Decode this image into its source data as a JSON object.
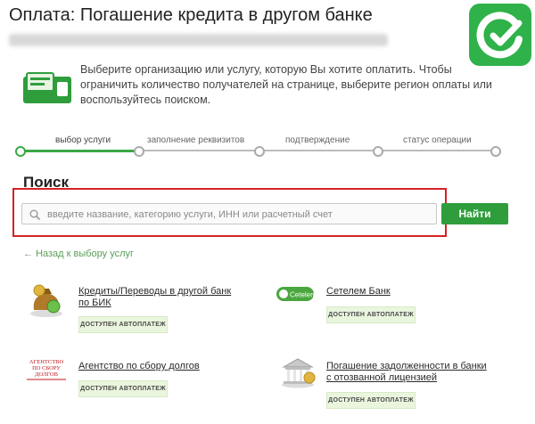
{
  "page": {
    "title": "Оплата: Погашение кредита в другом банке",
    "region": "НИЖЕГОРОДСКАЯ ОБЛАСТЬ, Г. НИЖНИЙ НОВГОРОД"
  },
  "intro": {
    "text": "Выберите организацию или услугу, которую Вы хотите оплатить. Чтобы ограничить количество получателей на странице, выберите регион оплаты или воспользуйтесь поиском."
  },
  "steps": [
    {
      "label": "выбор услуги",
      "active": true
    },
    {
      "label": "заполнение реквизитов",
      "active": false
    },
    {
      "label": "подтверждение",
      "active": false
    },
    {
      "label": "статус операции",
      "active": false
    }
  ],
  "search": {
    "heading": "Поиск",
    "placeholder": "введите название, категорию услуги, ИНН или расчетный счет",
    "value": "",
    "button": "Найти"
  },
  "back_link": "Назад к выбору услуг",
  "services": [
    {
      "name": "Кредиты/Переводы в другой банк по БИК",
      "badge": "ДОСТУПЕН АВТОПЛАТЕЖ",
      "icon": "money-bag-icon"
    },
    {
      "name": "Сетелем Банк",
      "badge": "ДОСТУПЕН АВТОПЛАТЕЖ",
      "icon": "cetelem-logo",
      "logo_text": "Cetelem"
    },
    {
      "name": "Агентство по сбору долгов",
      "badge": "ДОСТУПЕН АВТОПЛАТЕЖ",
      "icon": "debt-agency-logo",
      "logo_text": "АГЕНТСТВО ПО СБОРУ ДОЛГОВ"
    },
    {
      "name": "Погашение задолженности в банки с отозванной лицензией",
      "badge": "ДОСТУПЕН АВТОПЛАТЕЖ",
      "icon": "bank-building-icon"
    }
  ],
  "colors": {
    "accent_green": "#2f9d3c",
    "highlight_red": "#d42226",
    "badge_bg": "#eaf5de"
  }
}
